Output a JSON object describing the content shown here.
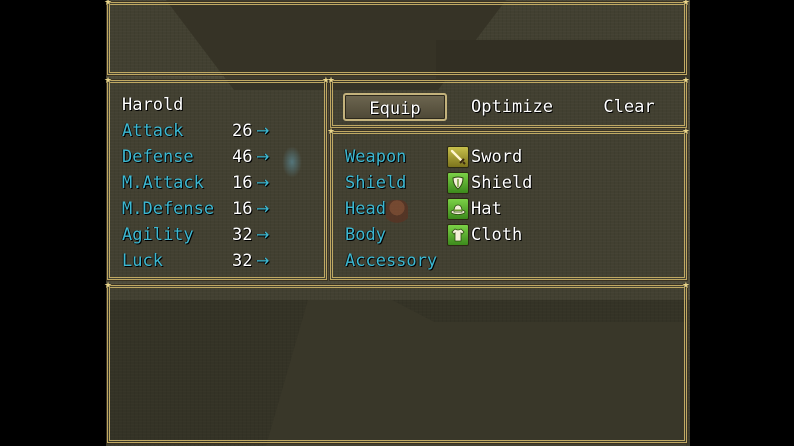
{
  "actor": {
    "name": "Harold"
  },
  "stats": [
    {
      "label": "Attack",
      "value": "26",
      "arrow": "→"
    },
    {
      "label": "Defense",
      "value": "46",
      "arrow": "→"
    },
    {
      "label": "M.Attack",
      "value": "16",
      "arrow": "→"
    },
    {
      "label": "M.Defense",
      "value": "16",
      "arrow": "→"
    },
    {
      "label": "Agility",
      "value": "32",
      "arrow": "→"
    },
    {
      "label": "Luck",
      "value": "32",
      "arrow": "→"
    }
  ],
  "commands": [
    {
      "label": "Equip",
      "selected": true
    },
    {
      "label": "Optimize",
      "selected": false
    },
    {
      "label": "Clear",
      "selected": false
    }
  ],
  "slots": [
    {
      "slot": "Weapon",
      "item": "Sword",
      "icon": "sword-icon"
    },
    {
      "slot": "Shield",
      "item": "Shield",
      "icon": "shield-icon"
    },
    {
      "slot": "Head",
      "item": "Hat",
      "icon": "hat-icon"
    },
    {
      "slot": "Body",
      "item": "Cloth",
      "icon": "cloth-icon"
    },
    {
      "slot": "Accessory",
      "item": "",
      "icon": ""
    }
  ],
  "colors": {
    "system_text": "#3cb8d2",
    "normal_text": "#ffffff",
    "frame": "#bfa863",
    "background": "#4f4c3b"
  }
}
